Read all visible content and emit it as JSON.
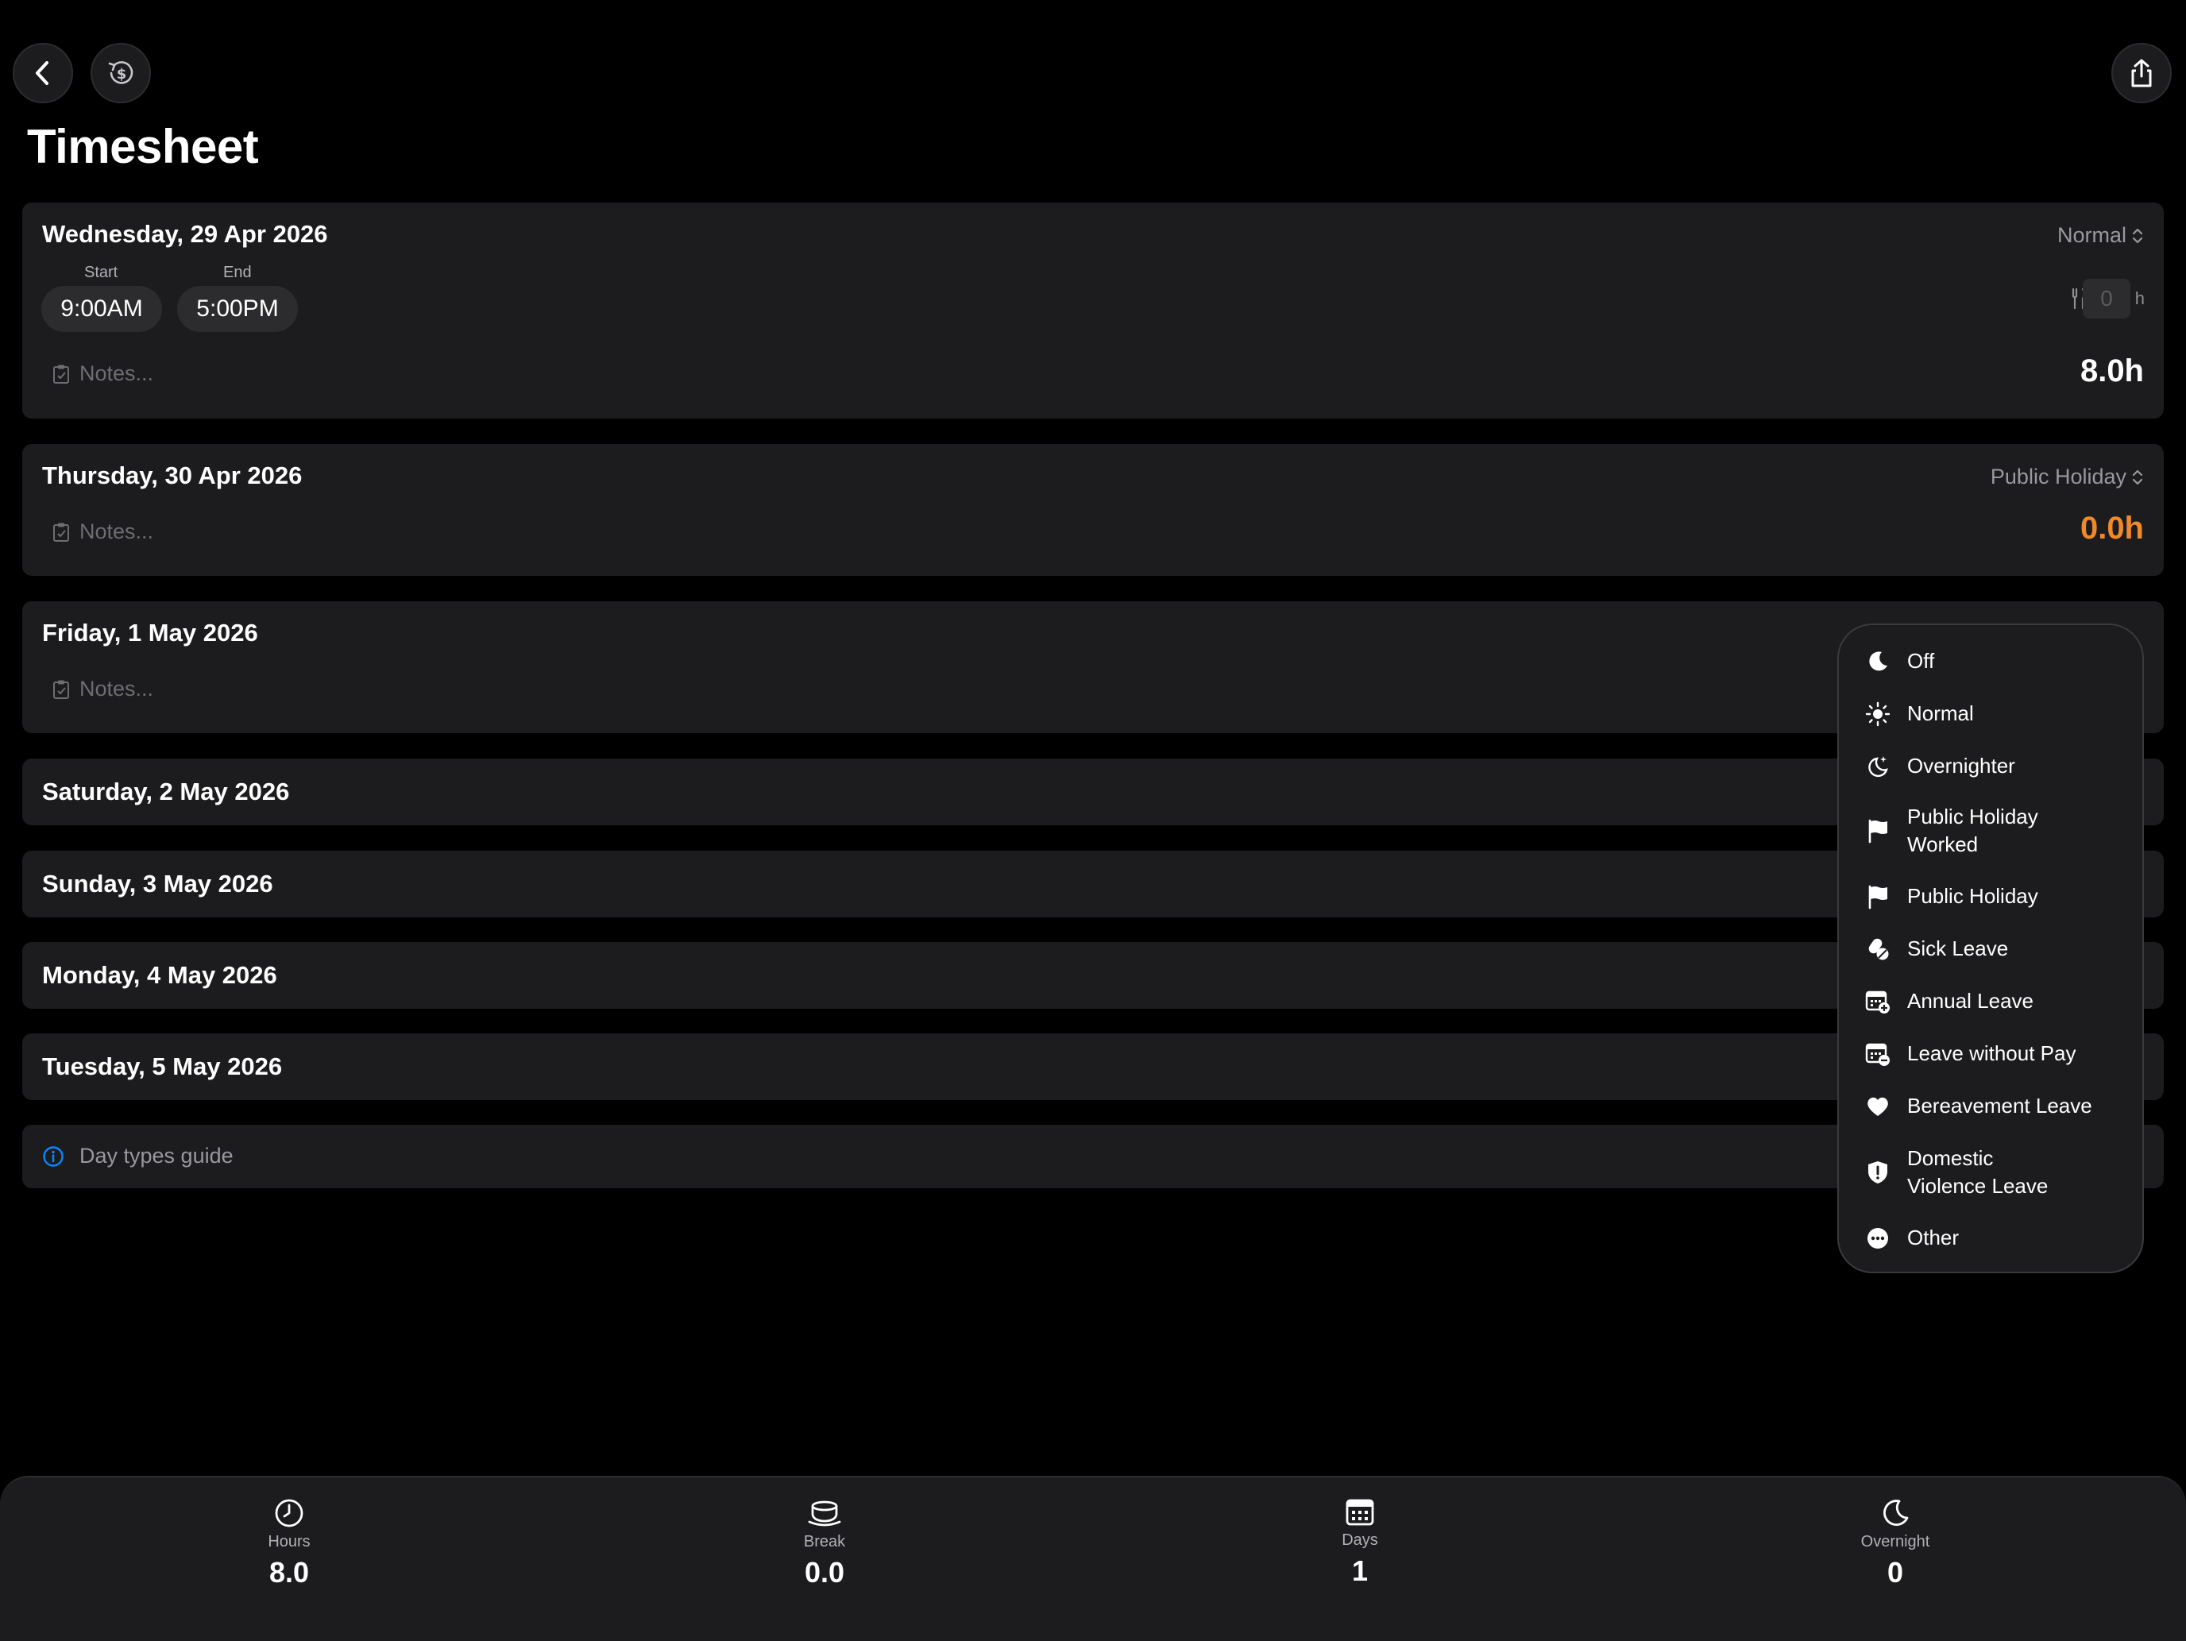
{
  "page": {
    "title": "Timesheet"
  },
  "days": [
    {
      "title": "Wednesday, 29 Apr 2026",
      "type": "Normal",
      "start_label": "Start",
      "end_label": "End",
      "start": "9:00AM",
      "end": "5:00PM",
      "break_value": "0",
      "break_unit": "h",
      "notes_placeholder": "Notes...",
      "total": "8.0h"
    },
    {
      "title": "Thursday, 30 Apr 2026",
      "type": "Public Holiday",
      "notes_placeholder": "Notes...",
      "total": "0.0h"
    },
    {
      "title": "Friday, 1 May 2026",
      "notes_placeholder": "Notes..."
    },
    {
      "title": "Saturday, 2 May 2026"
    },
    {
      "title": "Sunday, 3 May 2026"
    },
    {
      "title": "Monday, 4 May 2026"
    },
    {
      "title": "Tuesday, 5 May 2026"
    }
  ],
  "guide": {
    "label": "Day types guide"
  },
  "menu": {
    "items": [
      {
        "label": "Off",
        "icon": "moon-icon"
      },
      {
        "label": "Normal",
        "icon": "sun-icon"
      },
      {
        "label": "Overnighter",
        "icon": "moon-stars-icon"
      },
      {
        "label": "Public Holiday Worked",
        "icon": "flag-icon"
      },
      {
        "label": "Public Holiday",
        "icon": "flag-icon"
      },
      {
        "label": "Sick Leave",
        "icon": "pills-icon"
      },
      {
        "label": "Annual Leave",
        "icon": "calendar-plus-icon"
      },
      {
        "label": "Leave without Pay",
        "icon": "calendar-minus-icon"
      },
      {
        "label": "Bereavement Leave",
        "icon": "heart-icon"
      },
      {
        "label": "Domestic Violence Leave",
        "icon": "shield-exclamation-icon"
      },
      {
        "label": "Other",
        "icon": "ellipsis-circle-icon"
      }
    ]
  },
  "summary": {
    "hours_label": "Hours",
    "hours": "8.0",
    "break_label": "Break",
    "break": "0.0",
    "days_label": "Days",
    "days": "1",
    "overnight_label": "Overnight",
    "overnight": "0"
  },
  "colors": {
    "accent_orange": "#f0892a",
    "info_blue": "#0a84ff",
    "card": "#1c1c1e"
  }
}
